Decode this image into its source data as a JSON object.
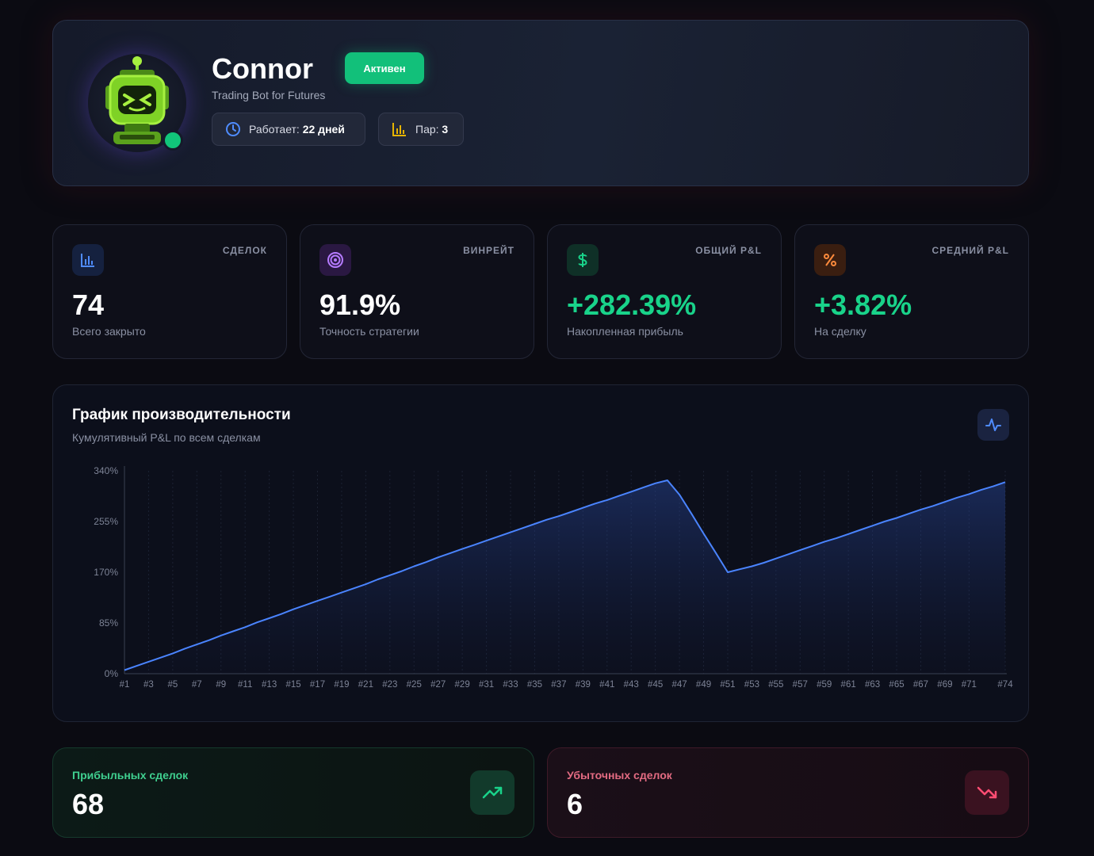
{
  "bot": {
    "name": "Connor",
    "status": "Активен",
    "subtitle": "Trading Bot for Futures",
    "uptime_label": "Работает:",
    "uptime_value": "22 дней",
    "pairs_label": "Пар:",
    "pairs_value": "3"
  },
  "stats": [
    {
      "label": "СДЕЛОК",
      "value": "74",
      "desc": "Всего закрыто",
      "icon": "bar-chart-icon",
      "color": "#4f8cff"
    },
    {
      "label": "ВИНРЕЙТ",
      "value": "91.9%",
      "desc": "Точность стратегии",
      "icon": "target-icon",
      "color": "#b57bff"
    },
    {
      "label": "ОБЩИЙ P&L",
      "value": "+282.39%",
      "desc": "Накопленная прибыль",
      "icon": "dollar-icon",
      "color": "#19d38a"
    },
    {
      "label": "СРЕДНИЙ P&L",
      "value": "+3.82%",
      "desc": "На сделку",
      "icon": "percent-icon",
      "color": "#ff8a3c"
    }
  ],
  "chart": {
    "title": "График производительности",
    "subtitle": "Кумулятивный P&L по всем сделкам"
  },
  "chart_data": {
    "type": "area",
    "x_ticks": [
      "#1",
      "#3",
      "#5",
      "#7",
      "#9",
      "#11",
      "#13",
      "#15",
      "#17",
      "#19",
      "#21",
      "#23",
      "#25",
      "#27",
      "#29",
      "#31",
      "#33",
      "#35",
      "#37",
      "#39",
      "#41",
      "#43",
      "#45",
      "#47",
      "#49",
      "#51",
      "#53",
      "#55",
      "#57",
      "#59",
      "#61",
      "#63",
      "#65",
      "#67",
      "#69",
      "#71",
      "#74"
    ],
    "y_ticks": [
      "0%",
      "85%",
      "170%",
      "255%",
      "340%"
    ],
    "ylim": [
      0,
      340
    ],
    "series": [
      {
        "values": [
          6,
          13,
          20,
          27,
          34,
          42,
          49,
          56,
          64,
          71,
          78,
          86,
          93,
          100,
          108,
          115,
          122,
          129,
          136,
          143,
          150,
          158,
          165,
          172,
          180,
          187,
          195,
          202,
          209,
          216,
          223,
          230,
          237,
          244,
          251,
          258,
          264,
          271,
          278,
          285,
          291,
          298,
          305,
          312,
          319,
          324,
          300,
          268,
          235,
          203,
          170,
          175,
          180,
          186,
          193,
          200,
          207,
          214,
          221,
          227,
          234,
          241,
          248,
          255,
          261,
          268,
          275,
          281,
          288,
          295,
          301,
          308,
          314,
          321
        ],
        "color": "#4a84ff"
      }
    ],
    "grid": true
  },
  "winning": {
    "label": "Прибыльных сделок",
    "value": "68",
    "icon": "trend-up-icon"
  },
  "losing": {
    "label": "Убыточных сделок",
    "value": "6",
    "icon": "trend-down-icon"
  }
}
